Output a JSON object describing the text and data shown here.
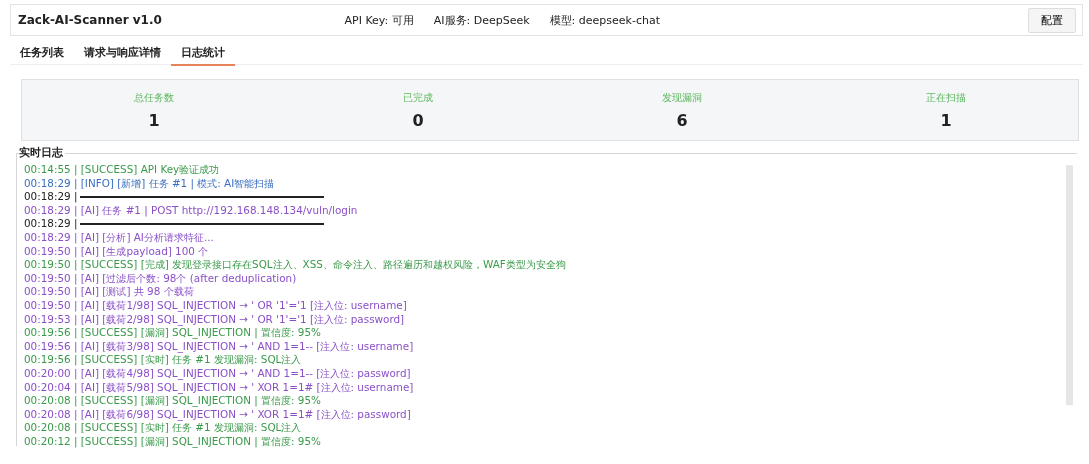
{
  "header": {
    "title": "Zack-AI-Scanner v1.0",
    "status": [
      "API Key: 可用",
      "AI服务: DeepSeek",
      "模型: deepseek-chat"
    ],
    "button": "配置"
  },
  "tabs": [
    {
      "label": "任务列表",
      "selected": false
    },
    {
      "label": "请求与响应详情",
      "selected": false
    },
    {
      "label": "日志统计",
      "selected": true
    }
  ],
  "stats": [
    {
      "label": "总任务数",
      "value": "1"
    },
    {
      "label": "已完成",
      "value": "0"
    },
    {
      "label": "发现漏洞",
      "value": "6"
    },
    {
      "label": "正在扫描",
      "value": "1"
    }
  ],
  "log": {
    "title": "实时日志",
    "lines": [
      {
        "kind": "success",
        "text": "00:14:55 | [SUCCESS] API Key验证成功"
      },
      {
        "kind": "info",
        "text": "00:18:29 | [INFO] [新增] 任务 #1 | 模式: AI智能扫描"
      },
      {
        "kind": "divider",
        "text": "00:18:29 |"
      },
      {
        "kind": "ai",
        "text": "00:18:29 | [AI] 任务 #1 | POST http://192.168.148.134/vuln/login"
      },
      {
        "kind": "divider",
        "text": "00:18:29 |"
      },
      {
        "kind": "ai",
        "text": "00:18:29 | [AI] [分析] AI分析请求特征..."
      },
      {
        "kind": "ai",
        "text": "00:19:50 | [AI] [生成payload] 100 个"
      },
      {
        "kind": "success",
        "text": "00:19:50 | [SUCCESS] [完成] 发现登录接口存在SQL注入、XSS、命令注入、路径遍历和越权风险，WAF类型为安全狗"
      },
      {
        "kind": "ai",
        "text": "00:19:50 | [AI] [过滤后个数: 98个 (after deduplication)"
      },
      {
        "kind": "ai",
        "text": "00:19:50 | [AI] [测试] 共 98 个载荷"
      },
      {
        "kind": "ai",
        "text": "00:19:50 | [AI] [载荷1/98] SQL_INJECTION → ' OR '1'='1 [注入位: username]"
      },
      {
        "kind": "ai",
        "text": "00:19:53 | [AI] [载荷2/98] SQL_INJECTION → ' OR '1'='1 [注入位: password]"
      },
      {
        "kind": "success",
        "text": "00:19:56 | [SUCCESS] [漏洞] SQL_INJECTION | 置信度: 95%"
      },
      {
        "kind": "ai",
        "text": "00:19:56 | [AI] [载荷3/98] SQL_INJECTION → ' AND 1=1-- [注入位: username]"
      },
      {
        "kind": "success",
        "text": "00:19:56 | [SUCCESS] [实时] 任务 #1 发现漏洞: SQL注入"
      },
      {
        "kind": "ai",
        "text": "00:20:00 | [AI] [载荷4/98] SQL_INJECTION → ' AND 1=1-- [注入位: password]"
      },
      {
        "kind": "ai",
        "text": "00:20:04 | [AI] [载荷5/98] SQL_INJECTION → ' XOR 1=1# [注入位: username]"
      },
      {
        "kind": "success",
        "text": "00:20:08 | [SUCCESS] [漏洞] SQL_INJECTION | 置信度: 95%"
      },
      {
        "kind": "ai",
        "text": "00:20:08 | [AI] [载荷6/98] SQL_INJECTION → ' XOR 1=1# [注入位: password]"
      },
      {
        "kind": "success",
        "text": "00:20:08 | [SUCCESS] [实时] 任务 #1 发现漏洞: SQL注入"
      },
      {
        "kind": "success",
        "text": "00:20:12 | [SUCCESS] [漏洞] SQL_INJECTION | 置信度: 95%"
      }
    ]
  }
}
